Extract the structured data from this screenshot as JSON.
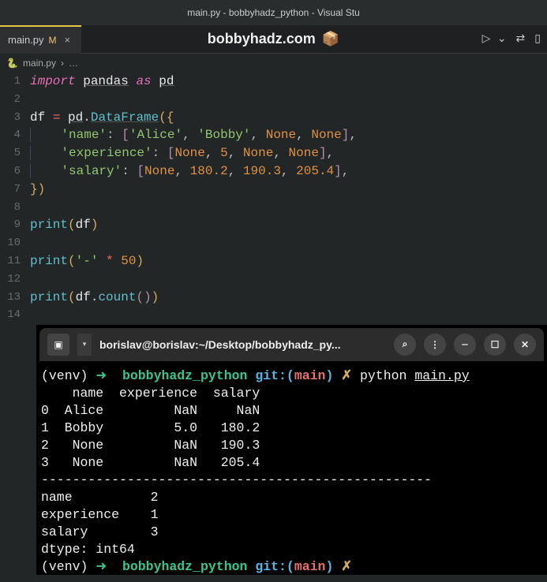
{
  "window": {
    "title": "main.py - bobbyhadz_python - Visual Stu"
  },
  "tab": {
    "filename": "main.py",
    "dirty_marker": "M",
    "close": "×"
  },
  "branding": {
    "text": "bobbyhadz.com",
    "icon": "📦"
  },
  "run": {
    "play": "▷",
    "dropdown": "⌄"
  },
  "breadcrumb": {
    "file": "main.py",
    "sep": "›",
    "ellipsis": "…"
  },
  "chart_data": {
    "type": "table",
    "title": "DataFrame df and df.count()",
    "dataframe": {
      "columns": [
        "name",
        "experience",
        "salary"
      ],
      "rows": [
        {
          "index": 0,
          "name": "Alice",
          "experience": null,
          "salary": null
        },
        {
          "index": 1,
          "name": "Bobby",
          "experience": 5.0,
          "salary": 180.2
        },
        {
          "index": 2,
          "name": null,
          "experience": null,
          "salary": 190.3
        },
        {
          "index": 3,
          "name": null,
          "experience": null,
          "salary": 205.4
        }
      ]
    },
    "count": {
      "name": 2,
      "experience": 1,
      "salary": 3,
      "dtype": "int64"
    },
    "separator_len": 50
  },
  "code": {
    "l1": {
      "import": "import",
      "pandas": "pandas",
      "as": "as",
      "pd": "pd"
    },
    "l3": {
      "df": "df",
      "eq": "=",
      "pd": "pd",
      "dot": ".",
      "DataFrame": "DataFrame",
      "op": "(",
      "br": "{"
    },
    "l4": {
      "key": "'name'",
      "colon": ":",
      "ob": "[",
      "v1": "'Alice'",
      "c": ",",
      "v2": "'Bobby'",
      "n1": "None",
      "n2": "None",
      "cb": "]"
    },
    "l5": {
      "key": "'experience'",
      "colon": ":",
      "ob": "[",
      "n1": "None",
      "c": ",",
      "v2": "5",
      "n2": "None",
      "n3": "None",
      "cb": "]"
    },
    "l6": {
      "key": "'salary'",
      "colon": ":",
      "ob": "[",
      "n1": "None",
      "c": ",",
      "v2": "180.2",
      "v3": "190.3",
      "v4": "205.4",
      "cb": "]"
    },
    "l7": {
      "cb": "}",
      "cp": ")"
    },
    "l9": {
      "print": "print",
      "op": "(",
      "df": "df",
      "cp": ")"
    },
    "l11": {
      "print": "print",
      "op": "(",
      "dash": "'-'",
      "star": "*",
      "fifty": "50",
      "cp": ")"
    },
    "l13": {
      "print": "print",
      "op": "(",
      "df": "df",
      "dot": ".",
      "count": "count",
      "op2": "(",
      "cp2": ")",
      "cp": ")"
    }
  },
  "gutter": [
    "1",
    "2",
    "3",
    "4",
    "5",
    "6",
    "7",
    "8",
    "9",
    "10",
    "11",
    "12",
    "13",
    "14"
  ],
  "terminal": {
    "header": {
      "new_tab": "▣",
      "dropdown": "▾",
      "title": "borislav@borislav:~/Desktop/bobbyhadz_py...",
      "search": "⌕",
      "menu": "⋮",
      "min": "—",
      "max": "☐",
      "close": "✕"
    },
    "lines": [
      "(venv) ➜  bobbyhadz_python git:(main) ✗ python main.py",
      "    name  experience  salary",
      "0  Alice         NaN     NaN",
      "1  Bobby         5.0   180.2",
      "2   None         NaN   190.3",
      "3   None         NaN   205.4",
      "--------------------------------------------------",
      "name          2",
      "experience    1",
      "salary        3",
      "dtype: int64",
      "(venv) ➜  bobbyhadz_python git:(main) ✗"
    ],
    "prompt": {
      "venv": "(venv)",
      "arrow": "➜",
      "dir": "bobbyhadz_python",
      "git": "git:(",
      "branch": "main",
      "gitc": ")",
      "x": "✗",
      "cmd": "python",
      "file": "main.py"
    }
  }
}
